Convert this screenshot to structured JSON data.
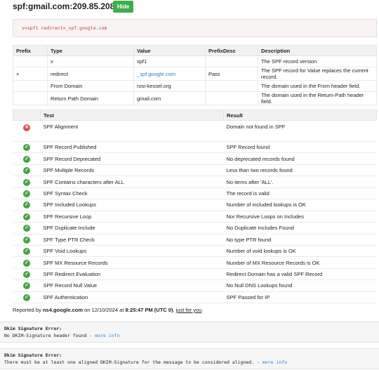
{
  "header": {
    "title": "spf:gmail.com:209.85.208.46",
    "hide_label": "Hide"
  },
  "raw_record": "v=spf1 redirect=_spf.google.com",
  "record_table": {
    "headers": [
      "Prefix",
      "Type",
      "Value",
      "PrefixDesc",
      "Description"
    ],
    "rows": [
      {
        "prefix": "",
        "type": "v",
        "value": "spf1",
        "prefixdesc": "",
        "description": "The SPF record version"
      },
      {
        "prefix": "+",
        "type": "redirect",
        "value": "_spf.google.com",
        "prefixdesc": "Pass",
        "description": "The SPF record for Value replaces the current record."
      },
      {
        "prefix": "",
        "type": "From Domain",
        "value": "rosi-kessel.org",
        "prefixdesc": "",
        "description": "The domain used in the From header field."
      },
      {
        "prefix": "",
        "type": "Return Path Domain",
        "value": "gmail.com",
        "prefixdesc": "",
        "description": "The domain used in the Return-Path header field."
      }
    ]
  },
  "test_table": {
    "headers": [
      "",
      "Test",
      "Result"
    ],
    "rows": [
      {
        "status": "error",
        "icon": "error-icon",
        "test": "SPF Alignment",
        "result": "Domain not found in SPF"
      },
      {
        "status": "ok",
        "icon": "check-icon",
        "test": "SPF Record Published",
        "result": "SPF Record found"
      },
      {
        "status": "ok",
        "icon": "check-icon",
        "test": "SPF Record Deprecated",
        "result": "No deprecated records found"
      },
      {
        "status": "ok",
        "icon": "check-icon",
        "test": "SPF Multiple Records",
        "result": "Less than two records found"
      },
      {
        "status": "ok",
        "icon": "check-icon",
        "test": "SPF Contains characters after ALL",
        "result": "No items after 'ALL'."
      },
      {
        "status": "ok",
        "icon": "check-icon",
        "test": "SPF Syntax Check",
        "result": "The record is valid"
      },
      {
        "status": "ok",
        "icon": "check-icon",
        "test": "SPF Included Lookups",
        "result": "Number of included lookups is OK"
      },
      {
        "status": "ok",
        "icon": "check-icon",
        "test": "SPF Recursive Loop",
        "result": "Nor Recursive Loops on Includes"
      },
      {
        "status": "ok",
        "icon": "check-icon",
        "test": "SPF Duplicate Include",
        "result": "No Duplicate Includes Found"
      },
      {
        "status": "ok",
        "icon": "check-icon",
        "test": "SPF Type PTR Check",
        "result": "No type PTR found"
      },
      {
        "status": "ok",
        "icon": "check-icon",
        "test": "SPF Void Lookups",
        "result": "Number of void lookups is OK"
      },
      {
        "status": "ok",
        "icon": "check-icon",
        "test": "SPF MX Resource Records",
        "result": "Number of MX Resource Records is OK"
      },
      {
        "status": "ok",
        "icon": "check-icon",
        "test": "SPF Redirect Evaluation",
        "result": "Redirect Domain has a valid SPF Record"
      },
      {
        "status": "ok",
        "icon": "check-icon",
        "test": "SPF Record Null Value",
        "result": "No Null DNS Lookups found"
      },
      {
        "status": "ok",
        "icon": "check-icon",
        "test": "SPF Authentication",
        "result": "SPF Passed for IP"
      }
    ]
  },
  "report": {
    "prefix": "Reported by ",
    "server": "ns4.google.com",
    "on": " on 12/10/2024 at ",
    "time": "8:25:47 PM (UTC 0)",
    "sep": ", ",
    "link": "just for you",
    "end": "."
  },
  "dkim_errors": [
    {
      "title": "Dkim Signature Error:",
      "message": "No DKIM-Signature header found",
      "sep": " - ",
      "link": "more info"
    },
    {
      "title": "Dkim Signature Error:",
      "message": "There must be at least one aligned DKIM-Signature for the message to be considered aligned.",
      "sep": " - ",
      "link": "more info"
    }
  ],
  "colors": {
    "accent_green": "#3fae49",
    "ok": "#47a447",
    "error": "#d9534f",
    "link": "#2a7fc9",
    "raw_text": "#c43a3a"
  }
}
